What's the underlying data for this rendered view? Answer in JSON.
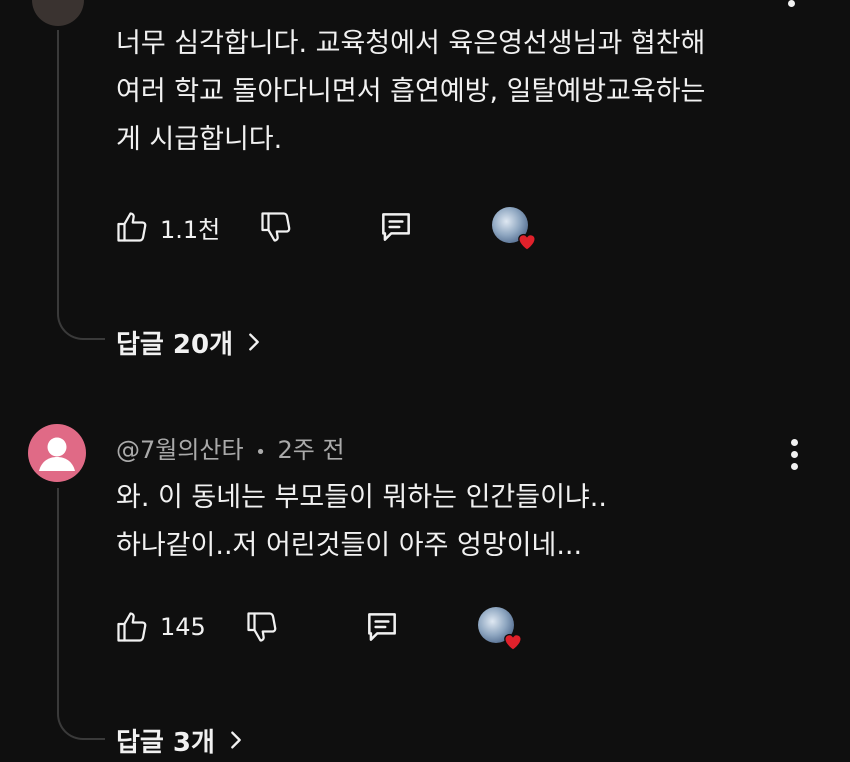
{
  "comments": [
    {
      "lines": [
        "너무 심각합니다. 교육청에서 육은영선생님과 협찬해",
        "여러 학교 돌아다니면서 흡연예방, 일탈예방교육하는",
        "게 시급합니다."
      ],
      "likes": "1.1천",
      "replies_label": "답글 20개"
    },
    {
      "author": "@7월의산타",
      "separator": "•",
      "time": "2주 전",
      "lines": [
        "와. 이 동네는 부모들이 뭐하는 인간들이냐..",
        "하나같이..저 어린것들이 아주 엉망이네..."
      ],
      "likes": "145",
      "replies_label": "답글 3개"
    }
  ],
  "colors": {
    "background": "#0f0f0f",
    "text": "#f1f1f1",
    "meta": "#aaaaaa",
    "avatar": "#e06a86",
    "heart": "#e0212b",
    "thread_line": "#3a3a3a"
  },
  "icons": [
    "like-icon",
    "dislike-icon",
    "reply-icon",
    "creator-heart-icon",
    "more-options-icon",
    "chevron-right-icon"
  ]
}
